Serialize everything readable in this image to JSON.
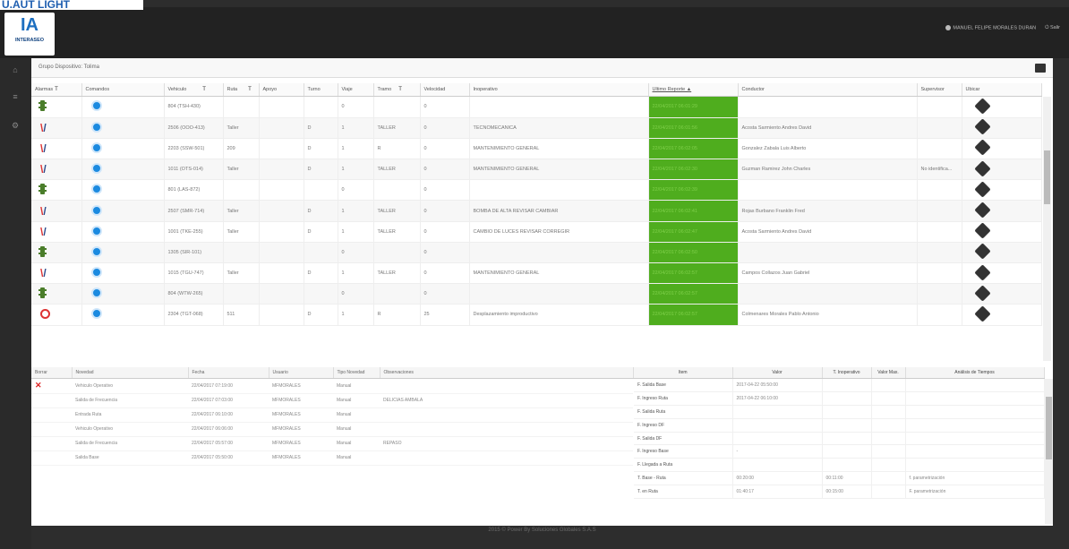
{
  "brand": "U.AUT LIGHT",
  "logo": {
    "mark": "IA",
    "text": "INTERASEO"
  },
  "user": {
    "name": "MANUEL FELIPE MORALES DURAN",
    "exit": "Salir"
  },
  "group_title": "Grupo Dispositivo: Tolima",
  "grid": {
    "headers": [
      "Alarmas",
      "Comandos",
      "Vehiculo",
      "Ruta",
      "Apoyo",
      "Turno",
      "Viaje",
      "Tramo",
      "Velocidad",
      "Inoperativo",
      "Ultimo Reporte ▲",
      "Conductor",
      "Supervisor",
      "Ubicar"
    ],
    "rows": [
      {
        "alarm": "semaphore",
        "vehiculo": "804 (TSH-430)",
        "ruta": "",
        "apoyo": "",
        "turno": "",
        "viaje": "0",
        "tramo": "",
        "velocidad": "0",
        "inoperativo": "",
        "reporte": "22/04/2017 06:01:29",
        "conductor": "",
        "supervisor": ""
      },
      {
        "alarm": "x",
        "vehiculo": "2506 (OOO-413)",
        "ruta": "Taller",
        "apoyo": "",
        "turno": "D",
        "viaje": "1",
        "tramo": "TALLER",
        "velocidad": "0",
        "inoperativo": "TECNOMECANICA",
        "reporte": "22/04/2017 06:01:56",
        "conductor": "Acosta Sarmiento Andres David",
        "supervisor": ""
      },
      {
        "alarm": "x",
        "vehiculo": "2203 (SSW-501)",
        "ruta": "209",
        "apoyo": "",
        "turno": "D",
        "viaje": "1",
        "tramo": "R",
        "velocidad": "0",
        "inoperativo": "MANTENIMIENTO GENERAL",
        "reporte": "22/04/2017 06:02:05",
        "conductor": "Gonzalez Zabala Luis Alberto",
        "supervisor": ""
      },
      {
        "alarm": "x",
        "vehiculo": "1011 (OTS-014)",
        "ruta": "Taller",
        "apoyo": "",
        "turno": "D",
        "viaje": "1",
        "tramo": "TALLER",
        "velocidad": "0",
        "inoperativo": "MANTENIMIENTO GENERAL",
        "reporte": "22/04/2017 06:02:30",
        "conductor": "Guzman Ramirez John Charles",
        "supervisor": "No identifica..."
      },
      {
        "alarm": "semaphore",
        "vehiculo": "801 (LAS-872)",
        "ruta": "",
        "apoyo": "",
        "turno": "",
        "viaje": "0",
        "tramo": "",
        "velocidad": "0",
        "inoperativo": "",
        "reporte": "22/04/2017 06:02:39",
        "conductor": "",
        "supervisor": ""
      },
      {
        "alarm": "x",
        "vehiculo": "2507 (SMR-714)",
        "ruta": "Taller",
        "apoyo": "",
        "turno": "D",
        "viaje": "1",
        "tramo": "TALLER",
        "velocidad": "0",
        "inoperativo": "BOMBA DE ALTA REVISAR CAMBIAR",
        "reporte": "22/04/2017 06:02:41",
        "conductor": "Rojas Burbano Franklin Fred",
        "supervisor": ""
      },
      {
        "alarm": "x",
        "vehiculo": "1001 (TKE-255)",
        "ruta": "Taller",
        "apoyo": "",
        "turno": "D",
        "viaje": "1",
        "tramo": "TALLER",
        "velocidad": "0",
        "inoperativo": "CAMBIO DE LUCES REVISAR CORREGIR",
        "reporte": "22/04/2017 06:02:47",
        "conductor": "Acosta Sarmiento Andres David",
        "supervisor": ""
      },
      {
        "alarm": "semaphore",
        "vehiculo": "1305 (SIR-101)",
        "ruta": "",
        "apoyo": "",
        "turno": "",
        "viaje": "0",
        "tramo": "",
        "velocidad": "0",
        "inoperativo": "",
        "reporte": "22/04/2017 06:02:50",
        "conductor": "",
        "supervisor": ""
      },
      {
        "alarm": "x",
        "vehiculo": "1015 (TGU-747)",
        "ruta": "Taller",
        "apoyo": "",
        "turno": "D",
        "viaje": "1",
        "tramo": "TALLER",
        "velocidad": "0",
        "inoperativo": "MANTENIMIENTO GENERAL",
        "reporte": "22/04/2017 06:02:57",
        "conductor": "Campos Collazos Juan Gabriel",
        "supervisor": ""
      },
      {
        "alarm": "semaphore",
        "vehiculo": "804 (WTW-265)",
        "ruta": "",
        "apoyo": "",
        "turno": "",
        "viaje": "0",
        "tramo": "",
        "velocidad": "0",
        "inoperativo": "",
        "reporte": "22/04/2017 06:02:57",
        "conductor": "",
        "supervisor": ""
      },
      {
        "alarm": "clock",
        "vehiculo": "2304 (TGT-068)",
        "ruta": "511",
        "apoyo": "",
        "turno": "D",
        "viaje": "1",
        "tramo": "R",
        "velocidad": "25",
        "inoperativo": "Desplazamiento improductivo",
        "reporte": "22/04/2017 06:02:57",
        "conductor": "Colmenares Morales Pablo Antonio",
        "supervisor": ""
      }
    ]
  },
  "novedades": {
    "headers": [
      "Borrar",
      "Novedad",
      "Fecha",
      "Usuario",
      "Tipo Novedad",
      "Observaciones"
    ],
    "rows": [
      {
        "novedad": "Vehiculo Operativo",
        "fecha": "22/04/2017 07:19:00",
        "usuario": "MFMORALES",
        "tipo": "Manual",
        "obs": ""
      },
      {
        "novedad": "Salida de Frecuencia",
        "fecha": "22/04/2017 07:03:00",
        "usuario": "MFMORALES",
        "tipo": "Manual",
        "obs": "DELICIAS AMBALA"
      },
      {
        "novedad": "Entrada Ruta",
        "fecha": "22/04/2017 06:10:00",
        "usuario": "MFMORALES",
        "tipo": "Manual",
        "obs": ""
      },
      {
        "novedad": "Vehiculo Operativo",
        "fecha": "22/04/2017 06:06:00",
        "usuario": "MFMORALES",
        "tipo": "Manual",
        "obs": ""
      },
      {
        "novedad": "Salida de Frecuencia",
        "fecha": "22/04/2017 05:57:00",
        "usuario": "MFMORALES",
        "tipo": "Manual",
        "obs": "REPASO"
      },
      {
        "novedad": "Salida Base",
        "fecha": "22/04/2017 05:50:00",
        "usuario": "MFMORALES",
        "tipo": "Manual",
        "obs": ""
      }
    ]
  },
  "analisis": {
    "headers": [
      "Item",
      "Valor",
      "T. Inoperativo",
      "Valor Max.",
      "Análisis de Tiempos"
    ],
    "rows": [
      {
        "item": "F. Salida Base",
        "valor": "2017-04-22 05:50:00",
        "inop": "",
        "max": "",
        "analisis": ""
      },
      {
        "item": "F. Ingreso Ruta",
        "valor": "2017-04-22 06:10:00",
        "inop": "",
        "max": "",
        "analisis": ""
      },
      {
        "item": "F. Salida Ruta",
        "valor": "",
        "inop": "",
        "max": "",
        "analisis": ""
      },
      {
        "item": "F. Ingreso DF",
        "valor": "",
        "inop": "",
        "max": "",
        "analisis": ""
      },
      {
        "item": "F. Salida DF",
        "valor": "",
        "inop": "",
        "max": "",
        "analisis": ""
      },
      {
        "item": "F. Ingreso Base",
        "valor": "-",
        "inop": "",
        "max": "",
        "analisis": ""
      },
      {
        "item": "F. Llegada a Ruta",
        "valor": "",
        "inop": "",
        "max": "",
        "analisis": ""
      },
      {
        "item": "T. Base - Ruta",
        "valor": "00:20:00",
        "inop": "00:11:00",
        "max": "",
        "analisis": "f. parametrización"
      },
      {
        "item": "T. en Ruta",
        "valor": "01:40:17",
        "inop": "00:15:00",
        "max": "",
        "analisis": "F. parametrización"
      }
    ]
  },
  "footer": "2015 © Power By Soluciones Globales S.A.S",
  "colors": {
    "report_green": "#4fad1e",
    "accent_blue": "#1b8ae0",
    "alarm_red": "#dd3333"
  }
}
